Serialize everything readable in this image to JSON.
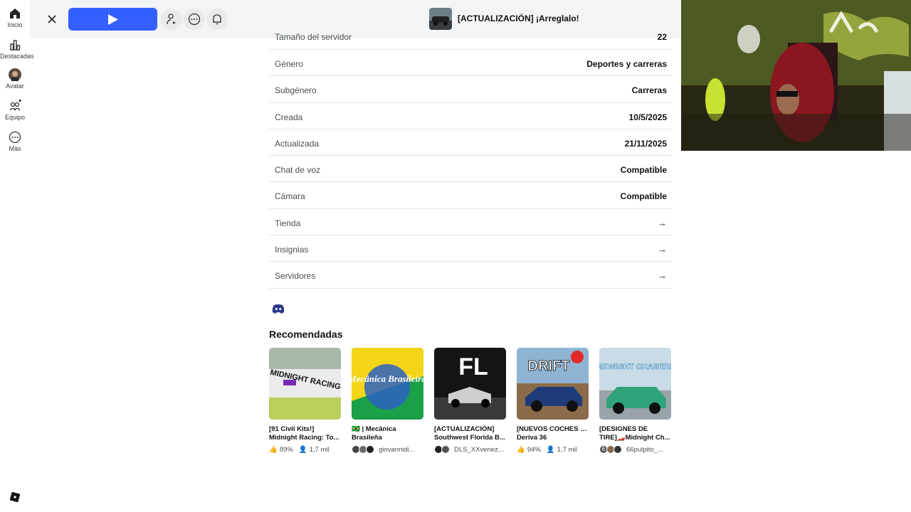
{
  "sidebar": {
    "items": [
      {
        "label": "Inicio",
        "icon": "home-icon"
      },
      {
        "label": "Destacadas",
        "icon": "chart-icon"
      },
      {
        "label": "Avatar",
        "icon": "avatar-icon"
      },
      {
        "label": "Equipo",
        "icon": "team-icon"
      },
      {
        "label": "Más",
        "icon": "more-icon"
      }
    ]
  },
  "topbar": {
    "game_title": "[ACTUALIZACIÓN] ¡Arreglalo!"
  },
  "details": {
    "partial_row": {
      "label": "Tamaño del servidor",
      "value": "22"
    },
    "rows": [
      {
        "label": "Género",
        "value": "Deportes y carreras"
      },
      {
        "label": "Subgénero",
        "value": "Carreras"
      },
      {
        "label": "Creada",
        "value": "10/5/2025"
      },
      {
        "label": "Actualizada",
        "value": "21/11/2025"
      },
      {
        "label": "Chat de voz",
        "value": "Compatible"
      },
      {
        "label": "Cámara",
        "value": "Compatible"
      }
    ],
    "links": [
      {
        "label": "Tienda",
        "arrow": "→"
      },
      {
        "label": "Insignias",
        "arrow": "→"
      },
      {
        "label": "Servidores",
        "arrow": "→"
      }
    ]
  },
  "recommended": {
    "title": "Recomendadas",
    "cards": [
      {
        "line1": "[91 Civil Kits!]",
        "line2": "Midnight Racing: To...",
        "rating": "89%",
        "players": "1,7 mil",
        "thumb_text": "MIDNIGHT RACING"
      },
      {
        "line1": "🇧🇷 | Mecânica",
        "line2": "Brasileña",
        "creator": "giovannidi...",
        "thumb_text": "Mecânica Brasileira"
      },
      {
        "line1": "[ACTUALIZACIÓN]",
        "line2": "Southwest Florida B...",
        "creator": "DLS_XXvenez...",
        "thumb_text": "FL"
      },
      {
        "line1": "[NUEVOS COCHES 🏁]",
        "line2": "Deriva 36",
        "rating": "94%",
        "players": "1,7 mil",
        "thumb_text": "DRIFT"
      },
      {
        "line1": "[DESIGNES DE",
        "line2": "TIRE]🏎️Midnight Ch...",
        "creator": "66pulpito_...",
        "badge": "6",
        "thumb_text": "MIDNIGHT CHASERS"
      }
    ]
  },
  "colors": {
    "accent": "#335fff",
    "topbar": "#f2f4f5",
    "divider": "#e3e5e6"
  }
}
